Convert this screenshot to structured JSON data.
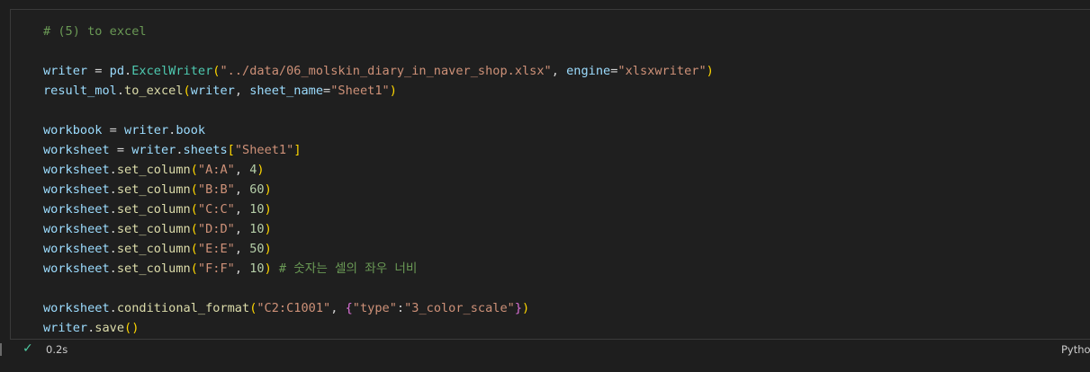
{
  "code_lines": [
    [
      {
        "t": "# (5) to excel",
        "c": "comment"
      }
    ],
    [],
    [
      {
        "t": "writer",
        "c": "var"
      },
      {
        "t": " = ",
        "c": "op"
      },
      {
        "t": "pd",
        "c": "var"
      },
      {
        "t": ".",
        "c": "op"
      },
      {
        "t": "ExcelWriter",
        "c": "type"
      },
      {
        "t": "(",
        "c": "p1"
      },
      {
        "t": "\"../data/06_molskin_diary_in_naver_shop.xlsx\"",
        "c": "str"
      },
      {
        "t": ", ",
        "c": "op"
      },
      {
        "t": "engine",
        "c": "var"
      },
      {
        "t": "=",
        "c": "op"
      },
      {
        "t": "\"xlsxwriter\"",
        "c": "str"
      },
      {
        "t": ")",
        "c": "p1"
      }
    ],
    [
      {
        "t": "result_mol",
        "c": "var"
      },
      {
        "t": ".",
        "c": "op"
      },
      {
        "t": "to_excel",
        "c": "fn"
      },
      {
        "t": "(",
        "c": "p1"
      },
      {
        "t": "writer",
        "c": "var"
      },
      {
        "t": ", ",
        "c": "op"
      },
      {
        "t": "sheet_name",
        "c": "var"
      },
      {
        "t": "=",
        "c": "op"
      },
      {
        "t": "\"Sheet1\"",
        "c": "str"
      },
      {
        "t": ")",
        "c": "p1"
      }
    ],
    [],
    [
      {
        "t": "workbook",
        "c": "var"
      },
      {
        "t": " = ",
        "c": "op"
      },
      {
        "t": "writer",
        "c": "var"
      },
      {
        "t": ".",
        "c": "op"
      },
      {
        "t": "book",
        "c": "var"
      }
    ],
    [
      {
        "t": "worksheet",
        "c": "var"
      },
      {
        "t": " = ",
        "c": "op"
      },
      {
        "t": "writer",
        "c": "var"
      },
      {
        "t": ".",
        "c": "op"
      },
      {
        "t": "sheets",
        "c": "var"
      },
      {
        "t": "[",
        "c": "p1"
      },
      {
        "t": "\"Sheet1\"",
        "c": "str"
      },
      {
        "t": "]",
        "c": "p1"
      }
    ],
    [
      {
        "t": "worksheet",
        "c": "var"
      },
      {
        "t": ".",
        "c": "op"
      },
      {
        "t": "set_column",
        "c": "fn"
      },
      {
        "t": "(",
        "c": "p1"
      },
      {
        "t": "\"A:A\"",
        "c": "str"
      },
      {
        "t": ", ",
        "c": "op"
      },
      {
        "t": "4",
        "c": "num"
      },
      {
        "t": ")",
        "c": "p1"
      }
    ],
    [
      {
        "t": "worksheet",
        "c": "var"
      },
      {
        "t": ".",
        "c": "op"
      },
      {
        "t": "set_column",
        "c": "fn"
      },
      {
        "t": "(",
        "c": "p1"
      },
      {
        "t": "\"B:B\"",
        "c": "str"
      },
      {
        "t": ", ",
        "c": "op"
      },
      {
        "t": "60",
        "c": "num"
      },
      {
        "t": ")",
        "c": "p1"
      }
    ],
    [
      {
        "t": "worksheet",
        "c": "var"
      },
      {
        "t": ".",
        "c": "op"
      },
      {
        "t": "set_column",
        "c": "fn"
      },
      {
        "t": "(",
        "c": "p1"
      },
      {
        "t": "\"C:C\"",
        "c": "str"
      },
      {
        "t": ", ",
        "c": "op"
      },
      {
        "t": "10",
        "c": "num"
      },
      {
        "t": ")",
        "c": "p1"
      }
    ],
    [
      {
        "t": "worksheet",
        "c": "var"
      },
      {
        "t": ".",
        "c": "op"
      },
      {
        "t": "set_column",
        "c": "fn"
      },
      {
        "t": "(",
        "c": "p1"
      },
      {
        "t": "\"D:D\"",
        "c": "str"
      },
      {
        "t": ", ",
        "c": "op"
      },
      {
        "t": "10",
        "c": "num"
      },
      {
        "t": ")",
        "c": "p1"
      }
    ],
    [
      {
        "t": "worksheet",
        "c": "var"
      },
      {
        "t": ".",
        "c": "op"
      },
      {
        "t": "set_column",
        "c": "fn"
      },
      {
        "t": "(",
        "c": "p1"
      },
      {
        "t": "\"E:E\"",
        "c": "str"
      },
      {
        "t": ", ",
        "c": "op"
      },
      {
        "t": "50",
        "c": "num"
      },
      {
        "t": ")",
        "c": "p1"
      }
    ],
    [
      {
        "t": "worksheet",
        "c": "var"
      },
      {
        "t": ".",
        "c": "op"
      },
      {
        "t": "set_column",
        "c": "fn"
      },
      {
        "t": "(",
        "c": "p1"
      },
      {
        "t": "\"F:F\"",
        "c": "str"
      },
      {
        "t": ", ",
        "c": "op"
      },
      {
        "t": "10",
        "c": "num"
      },
      {
        "t": ")",
        "c": "p1"
      },
      {
        "t": " # 숫자는 셀의 좌우 너비",
        "c": "comment"
      }
    ],
    [],
    [
      {
        "t": "worksheet",
        "c": "var"
      },
      {
        "t": ".",
        "c": "op"
      },
      {
        "t": "conditional_format",
        "c": "fn"
      },
      {
        "t": "(",
        "c": "p1"
      },
      {
        "t": "\"C2:C1001\"",
        "c": "str"
      },
      {
        "t": ", ",
        "c": "op"
      },
      {
        "t": "{",
        "c": "p2"
      },
      {
        "t": "\"type\"",
        "c": "str"
      },
      {
        "t": ":",
        "c": "op"
      },
      {
        "t": "\"3_color_scale\"",
        "c": "str"
      },
      {
        "t": "}",
        "c": "p2"
      },
      {
        "t": ")",
        "c": "p1"
      }
    ],
    [
      {
        "t": "writer",
        "c": "var"
      },
      {
        "t": ".",
        "c": "op"
      },
      {
        "t": "save",
        "c": "fn"
      },
      {
        "t": "()",
        "c": "p1"
      }
    ]
  ],
  "status": {
    "check_icon": "check-icon",
    "exec_time": "0.2s",
    "language": "Python"
  }
}
